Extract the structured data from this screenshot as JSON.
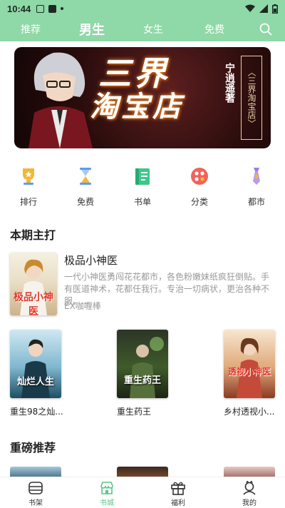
{
  "status": {
    "time": "10:44"
  },
  "top_tabs": [
    {
      "label": "推荐",
      "active": false
    },
    {
      "label": "男生",
      "active": true
    },
    {
      "label": "女生",
      "active": false
    },
    {
      "label": "免费",
      "active": false
    }
  ],
  "banner": {
    "title_line1": "三界",
    "title_line2": "淘宝店",
    "author": "宁逍遥著",
    "subtitle": "〈三界淘宝店〉"
  },
  "categories": [
    {
      "label": "排行",
      "icon": "trophy-icon",
      "color": "#f3b733"
    },
    {
      "label": "免费",
      "icon": "hourglass-icon",
      "color": "#5b9df0"
    },
    {
      "label": "书单",
      "icon": "book-icon",
      "color": "#3cc88a"
    },
    {
      "label": "分类",
      "icon": "grid-circle-icon",
      "color": "#f2625a"
    },
    {
      "label": "都市",
      "icon": "tie-icon",
      "color": "#9a7de8"
    }
  ],
  "section_featured": "本期主打",
  "featured": {
    "name": "极品小神医",
    "description": "一代小神医勇闯花花都市，各色粉嫩妹纸疯狂倒贴。手有医道神术，花都任我行。专治一切病状，更治各种不服。...",
    "author": "EX咖喱棒",
    "cover_text": "极品小神医"
  },
  "books": [
    {
      "name": "重生98之灿...",
      "cover_text": "灿烂人生"
    },
    {
      "name": "重生药王",
      "cover_text": "重生药王"
    },
    {
      "name": "乡村透视小...",
      "cover_text": "透视小神医"
    }
  ],
  "section_recommend": "重磅推荐",
  "bottom_nav": [
    {
      "label": "书架",
      "icon": "bookshelf-icon",
      "active": false
    },
    {
      "label": "书城",
      "icon": "store-icon",
      "active": true
    },
    {
      "label": "福利",
      "icon": "gift-icon",
      "active": false
    },
    {
      "label": "我的",
      "icon": "profile-icon",
      "active": false
    }
  ],
  "colors": {
    "accent": "#8fd8a7",
    "active_green": "#5cc489"
  }
}
